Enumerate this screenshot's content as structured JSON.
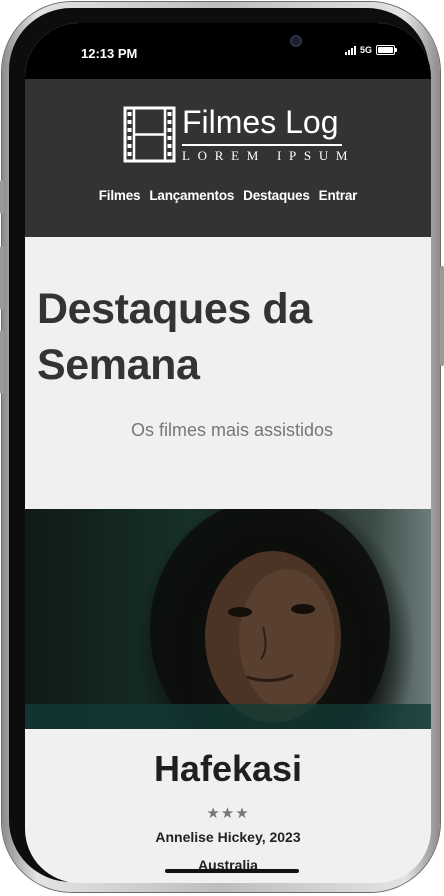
{
  "status_bar": {
    "time": "12:13 PM",
    "network": "5G"
  },
  "header": {
    "logo_title": "Filmes Log",
    "logo_subtitle": "LOREM IPSUM",
    "nav": [
      "Filmes",
      "Lançamentos",
      "Destaques",
      "Entrar"
    ]
  },
  "hero": {
    "title_line1": "Destaques da",
    "title_line2": "Semana",
    "subtitle": "Os filmes mais assistidos"
  },
  "movie": {
    "title": "Hafekasi",
    "rating": "★★★",
    "meta": "Annelise Hickey, 2023",
    "country": "Australia"
  },
  "colors": {
    "header_bg": "#333333",
    "page_bg": "#f0f0f0",
    "text_dark": "#333333"
  }
}
